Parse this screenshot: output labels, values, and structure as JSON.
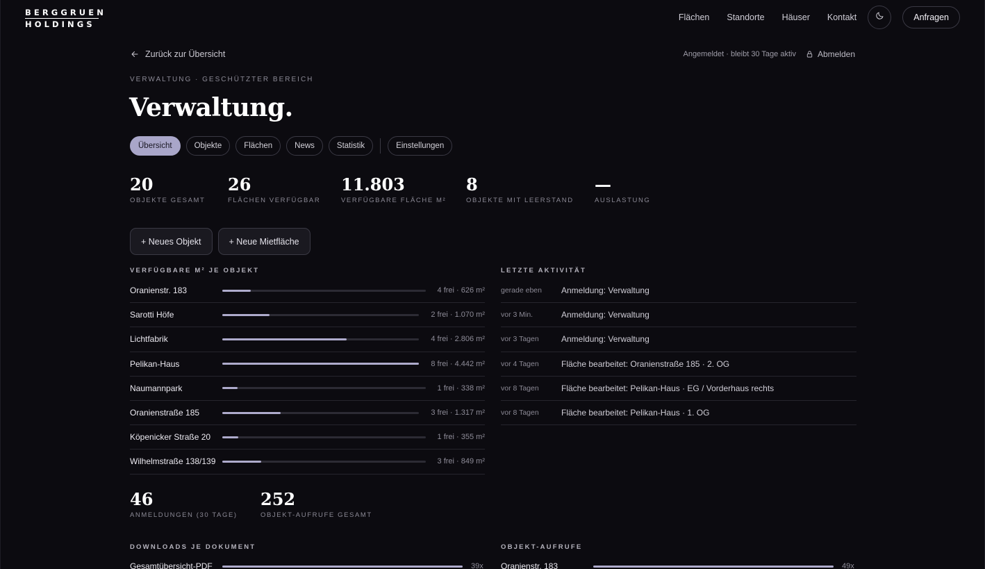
{
  "brand": {
    "line1": "BERGGRUEN",
    "line2": "HOLDINGS"
  },
  "nav": {
    "links": [
      "Flächen",
      "Standorte",
      "Häuser",
      "Kontakt"
    ],
    "cta": "Anfragen",
    "theme_icon": "moon-icon"
  },
  "back_link": "Zurück zur Übersicht",
  "session": {
    "status": "Angemeldet · bleibt 30 Tage aktiv",
    "logout": "Abmelden"
  },
  "eyebrow": "VERWALTUNG · GESCHÜTZTER BEREICH",
  "title": "Verwaltung.",
  "tabs": [
    "Übersicht",
    "Objekte",
    "Flächen",
    "News",
    "Statistik"
  ],
  "tab_settings": "Einstellungen",
  "active_tab": "Übersicht",
  "stats": [
    {
      "value": "20",
      "label": "OBJEKTE GESAMT"
    },
    {
      "value": "26",
      "label": "FLÄCHEN VERFÜGBAR"
    },
    {
      "value": "11.803",
      "label": "VERFÜGBARE FLÄCHE M²"
    },
    {
      "value": "8",
      "label": "OBJEKTE MIT LEERSTAND"
    },
    {
      "value": "—",
      "label": "AUSLASTUNG"
    }
  ],
  "actions": {
    "new_object": "+ Neues Objekt",
    "new_space": "+ Neue Mietfläche"
  },
  "sections": {
    "available": "VERFÜGBARE M² JE OBJEKT",
    "activity": "LETZTE AKTIVITÄT",
    "downloads": "DOWNLOADS JE DOKUMENT",
    "views": "OBJEKT-AUFRUFE"
  },
  "available": [
    {
      "name": "Oranienstr. 183",
      "value": "4 frei · 626 m²",
      "fraction": 0.141
    },
    {
      "name": "Sarotti Höfe",
      "value": "2 frei · 1.070 m²",
      "fraction": 0.241
    },
    {
      "name": "Lichtfabrik",
      "value": "4 frei · 2.806 m²",
      "fraction": 0.632
    },
    {
      "name": "Pelikan-Haus",
      "value": "8 frei · 4.442 m²",
      "fraction": 1.0
    },
    {
      "name": "Naumannpark",
      "value": "1 frei · 338 m²",
      "fraction": 0.076
    },
    {
      "name": "Oranienstraße 185",
      "value": "3 frei · 1.317 m²",
      "fraction": 0.296
    },
    {
      "name": "Köpenicker Straße 20",
      "value": "1 frei · 355 m²",
      "fraction": 0.08
    },
    {
      "name": "Wilhelmstraße 138/139",
      "value": "3 frei · 849 m²",
      "fraction": 0.191
    }
  ],
  "activity": [
    {
      "when": "gerade eben",
      "what": "Anmeldung: Verwaltung"
    },
    {
      "when": "vor 3 Min.",
      "what": "Anmeldung: Verwaltung"
    },
    {
      "when": "vor 3 Tagen",
      "what": "Anmeldung: Verwaltung"
    },
    {
      "when": "vor 4 Tagen",
      "what": "Fläche bearbeitet: Oranienstraße 185 · 2. OG"
    },
    {
      "when": "vor 8 Tagen",
      "what": "Fläche bearbeitet: Pelikan-Haus · EG / Vorderhaus rechts"
    },
    {
      "when": "vor 8 Tagen",
      "what": "Fläche bearbeitet: Pelikan-Haus · 1. OG"
    }
  ],
  "stats2": [
    {
      "value": "46",
      "label": "ANMELDUNGEN (30 TAGE)"
    },
    {
      "value": "252",
      "label": "OBJEKT-AUFRUFE GESAMT"
    }
  ],
  "downloads": [
    {
      "name": "Gesamtübersicht-PDF",
      "value": "39x",
      "fraction": 1.0
    }
  ],
  "views": [
    {
      "name": "Oranienstr. 183",
      "value": "49x",
      "fraction": 1.0
    }
  ]
}
